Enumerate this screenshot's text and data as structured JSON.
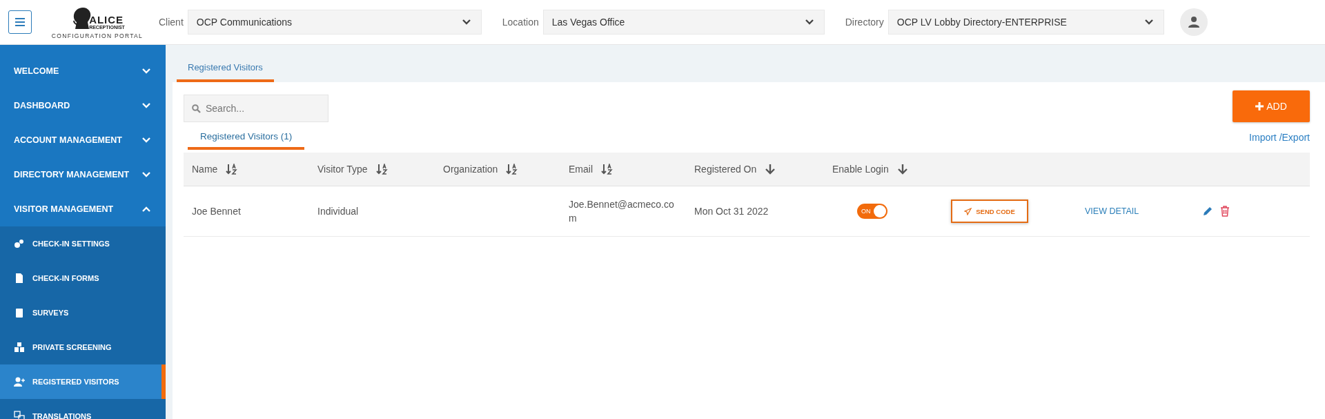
{
  "header": {
    "logo": {
      "name": "ALICE",
      "tagline": "RECEPTIONIST",
      "subtitle": "CONFIGURATION PORTAL"
    },
    "selectors": [
      {
        "label": "Client",
        "value": "OCP Communications"
      },
      {
        "label": "Location",
        "value": "Las Vegas Office"
      },
      {
        "label": "Directory",
        "value": "OCP LV Lobby Directory-ENTERPRISE"
      }
    ]
  },
  "sidebar": {
    "items": [
      {
        "label": "WELCOME",
        "expanded": false
      },
      {
        "label": "DASHBOARD",
        "expanded": false
      },
      {
        "label": "ACCOUNT MANAGEMENT",
        "expanded": false
      },
      {
        "label": "DIRECTORY MANAGEMENT",
        "expanded": false
      },
      {
        "label": "VISITOR MANAGEMENT",
        "expanded": true,
        "children": [
          {
            "label": "CHECK-IN SETTINGS",
            "selected": false
          },
          {
            "label": "CHECK-IN FORMS",
            "selected": false
          },
          {
            "label": "SURVEYS",
            "selected": false
          },
          {
            "label": "PRIVATE SCREENING",
            "selected": false
          },
          {
            "label": "REGISTERED VISITORS",
            "selected": true
          },
          {
            "label": "TRANSLATIONS",
            "selected": false
          }
        ]
      }
    ]
  },
  "page_tabs": [
    {
      "label": "Registered Visitors",
      "selected": true
    }
  ],
  "search": {
    "placeholder": "Search..."
  },
  "add_button": "ADD",
  "import_export": "Import /Export",
  "sub_tabs": [
    {
      "label": "Registered Visitors (1)",
      "selected": true
    }
  ],
  "table": {
    "columns": [
      {
        "label": "Name",
        "kind": "alpha"
      },
      {
        "label": "Visitor Type",
        "kind": "alpha"
      },
      {
        "label": "Organization",
        "kind": "alpha"
      },
      {
        "label": "Email",
        "kind": "alpha"
      },
      {
        "label": "Registered On",
        "kind": "arrow"
      },
      {
        "label": "Enable Login",
        "kind": "arrow"
      }
    ],
    "rows": [
      {
        "name": "Joe Bennet",
        "visitor_type": "Individual",
        "email": "Joe.Bennet@acmeco.com",
        "registered_on": "Mon Oct 31 2022",
        "login_enabled": true,
        "toggle_text": "ON",
        "send_code": "SEND CODE",
        "view_detail": "VIEW DETAIL"
      }
    ]
  }
}
